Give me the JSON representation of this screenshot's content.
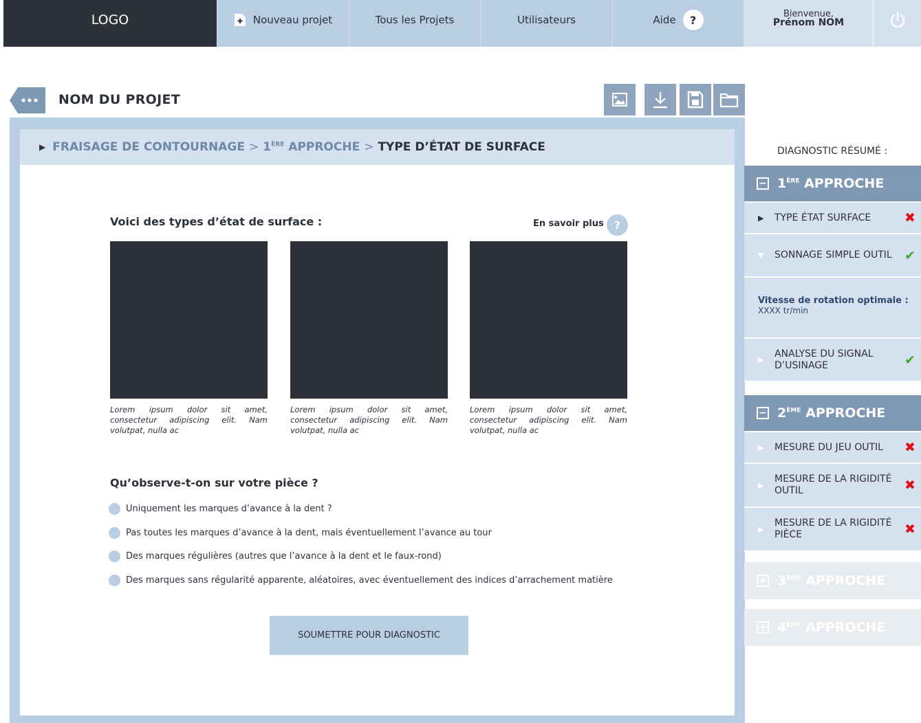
{
  "nav": {
    "logo": "LOGO",
    "new_project": "Nouveau projet",
    "all_projects": "Tous les Projets",
    "users": "Utilisateurs",
    "help": "Aide",
    "help_icon": "?",
    "welcome": "Bienvenue,",
    "user_name": "Prénom NOM"
  },
  "project": {
    "title": "NOM DU PROJET"
  },
  "breadcrumb": {
    "item1": "FRAISAGE DE CONTOURNAGE",
    "sep": ">",
    "item2_prefix": "1",
    "item2_sup": "ÈRE",
    "item2_rest": " APPROCHE",
    "current": "TYPE D’ÉTAT DE SURFACE"
  },
  "content": {
    "section_title": "Voici des types d’état de surface :",
    "learn_more": "En savoir plus",
    "learn_more_icon": "?",
    "captions": [
      "Lorem ipsum dolor sit amet, consectetur adipiscing elit. Nam volutpat, nulla ac",
      "Lorem ipsum dolor sit amet, consectetur adipiscing elit. Nam volutpat, nulla ac",
      "Lorem ipsum dolor sit amet, consectetur adipiscing elit. Nam volutpat, nulla ac"
    ],
    "question": "Qu’observe-t-on sur votre pièce ?",
    "options": [
      "Uniquement les marques d’avance à la dent ?",
      "Pas toutes les marques d’avance à la dent, mais éventuellement l’avance au tour",
      "Des marques régulières (autres que l’avance à la dent et le faux-rond)",
      "Des marques sans régularité apparente, aléatoires, avec éventuellement des indices d’arrachement matière"
    ],
    "submit": "SOUMETTRE POUR DIAGNOSTIC"
  },
  "sidebar": {
    "title": "DIAGNOSTIC RÉSUMÉ :",
    "approach1": {
      "num": "1",
      "sup": "ÈRE",
      "label": "APPROCHE"
    },
    "items1": [
      {
        "label": "TYPE ÉTAT SURFACE",
        "status": "✖"
      },
      {
        "label": "SONNAGE SIMPLE OUTIL",
        "status": "✔"
      }
    ],
    "info_label": "Vitesse de rotation optimale :",
    "info_value": "XXXX tr/min",
    "item1_3": {
      "label": "ANALYSE DU SIGNAL D’USINAGE",
      "status": "✔"
    },
    "approach2": {
      "num": "2",
      "sup": "ÈME",
      "label": "APPROCHE"
    },
    "items2": [
      {
        "label": "MESURE DU JEU OUTIL",
        "status": "✖"
      },
      {
        "label": "MESURE DE LA RIGIDITÉ OUTIL",
        "status": "✖"
      },
      {
        "label": "MESURE DE LA RIGIDITÉ PIÈCE",
        "status": "✖"
      }
    ],
    "approach3": {
      "num": "3",
      "sup": "ÈME",
      "label": "APPROCHE"
    },
    "approach4": {
      "num": "4",
      "sup": "ÈME",
      "label": "APPROCHE"
    },
    "minus_icon": "−",
    "plus_icon": "+"
  }
}
